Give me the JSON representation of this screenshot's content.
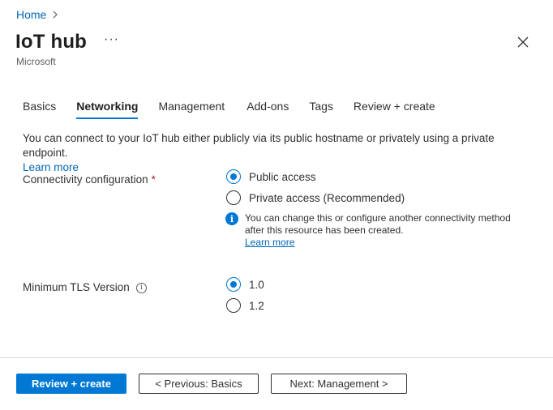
{
  "breadcrumb": {
    "home": "Home"
  },
  "header": {
    "title": "IoT hub",
    "more": "···",
    "subtitle": "Microsoft"
  },
  "tabs": [
    {
      "label": "Basics",
      "active": false
    },
    {
      "label": "Networking",
      "active": true
    },
    {
      "label": "Management",
      "active": false
    },
    {
      "label": "Add-ons",
      "active": false
    },
    {
      "label": "Tags",
      "active": false
    },
    {
      "label": "Review + create",
      "active": false
    }
  ],
  "description": {
    "text": "You can connect to your IoT hub either publicly via its public hostname or privately using a private endpoint.",
    "link": "Learn more"
  },
  "connectivity": {
    "label": "Connectivity configuration",
    "required": "*",
    "options": [
      {
        "label": "Public access",
        "checked": true
      },
      {
        "label": "Private access (Recommended)",
        "checked": false
      }
    ],
    "info": {
      "text": "You can change this or configure another connectivity method after this resource has been created.",
      "link": "Learn more"
    }
  },
  "tls": {
    "label": "Minimum TLS Version",
    "options": [
      {
        "label": "1.0",
        "checked": true
      },
      {
        "label": "1.2",
        "checked": false
      }
    ]
  },
  "footer": {
    "review_create": "Review + create",
    "previous": "< Previous: Basics",
    "next": "Next: Management >"
  },
  "colors": {
    "accent": "#0078d4",
    "link": "#0067b8",
    "required": "#a4262c"
  }
}
